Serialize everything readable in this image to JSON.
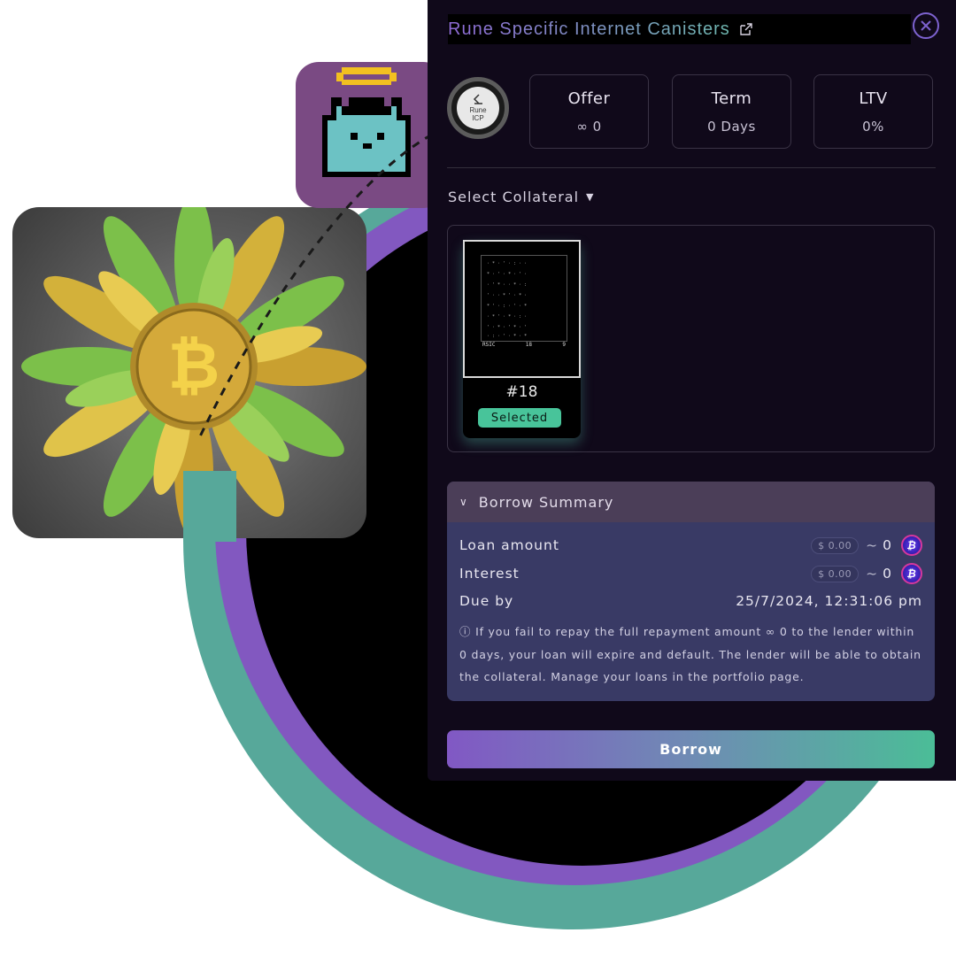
{
  "collection": {
    "title": "Rune Specific Internet Canisters",
    "logo_text": [
      "Rune",
      "ICP"
    ]
  },
  "stats": [
    {
      "label": "Offer",
      "value": "∞ 0"
    },
    {
      "label": "Term",
      "value": "0 Days"
    },
    {
      "label": "LTV",
      "value": "0%"
    }
  ],
  "collateral": {
    "select_label": "Select Collateral",
    "nft": {
      "id_label": "#18",
      "status": "Selected",
      "footer_left": "RSIC",
      "footer_mid": "18",
      "footer_right": "9"
    }
  },
  "summary": {
    "header": "Borrow Summary",
    "loan": {
      "label": "Loan amount",
      "usd": "$ 0.00",
      "amount": "0"
    },
    "interest": {
      "label": "Interest",
      "usd": "$ 0.00",
      "amount": "0"
    },
    "due": {
      "label": "Due by",
      "value": "25/7/2024, 12:31:06 pm"
    },
    "notice": "If you fail to repay the full repayment amount ∞ 0 to the lender within 0 days, your loan will expire and default. The lender will be able to obtain the collateral. Manage your loans in the portfolio page."
  },
  "borrow_button": "Borrow",
  "colors": {
    "accent_purple": "#8258c0",
    "accent_teal": "#57a89a",
    "selected_green": "#48c49a"
  }
}
